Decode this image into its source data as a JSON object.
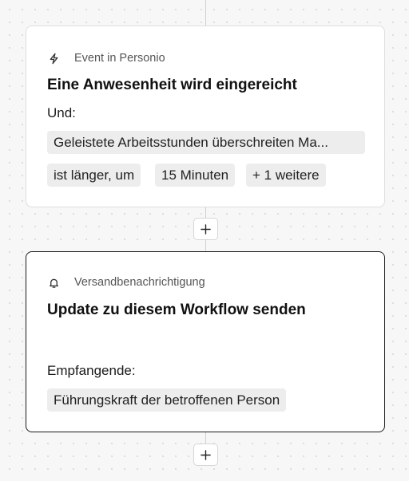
{
  "trigger_card": {
    "header_icon": "lightning-icon",
    "header_label": "Event in Personio",
    "title": "Eine Anwesenheit wird eingereicht",
    "condition_label": "Und:",
    "conditions": [
      "Geleistete Arbeitsstunden überschreiten Ma...",
      "ist länger, um",
      "15 Minuten",
      "+ 1 weitere"
    ]
  },
  "action_card": {
    "header_icon": "bell-icon",
    "header_label": "Versandbenachrichtigung",
    "title": "Update zu diesem Workflow senden",
    "recipients_label": "Empfangende:",
    "recipients": [
      "Führungskraft der betroffenen Person"
    ]
  },
  "add_step_icon": "plus-icon"
}
